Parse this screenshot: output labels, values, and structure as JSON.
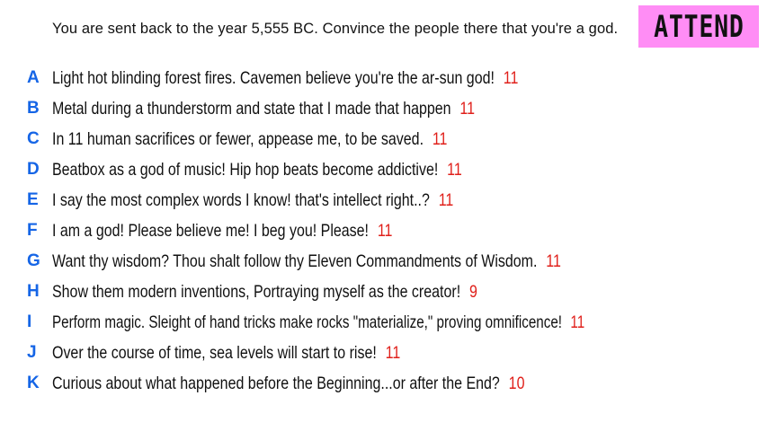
{
  "prompt": "You are sent back to the year 5,555 BC. Convince the people there that you're a god.",
  "badge": {
    "label": "ATTEND",
    "color": "#ff8df5"
  },
  "colors": {
    "letter": "#1565e6",
    "score": "#e0201b"
  },
  "answers": [
    {
      "letter": "A",
      "text": "Light hot blinding forest fires. Cavemen believe you're the ar-sun god!",
      "score": "11"
    },
    {
      "letter": "B",
      "text": "Metal during a thunderstorm and state that I made that happen",
      "score": "11"
    },
    {
      "letter": "C",
      "text": "In 11 human sacrifices or fewer, appease me, to be saved.",
      "score": "11"
    },
    {
      "letter": "D",
      "text": "Beatbox as a god of music! Hip hop beats become addictive!",
      "score": "11"
    },
    {
      "letter": "E",
      "text": "I say the most complex words I know! that's intellect right..?",
      "score": "11"
    },
    {
      "letter": "F",
      "text": "I am a god! Please believe me! I beg you! Please!",
      "score": "11"
    },
    {
      "letter": "G",
      "text": "Want thy wisdom? Thou shalt follow thy Eleven Commandments of Wisdom.",
      "score": "11"
    },
    {
      "letter": "H",
      "text": "Show them modern inventions, Portraying myself as the creator!",
      "score": "9"
    },
    {
      "letter": "I",
      "text": "Perform magic. Sleight of hand tricks make rocks \"materialize,\" proving omnificence!",
      "score": "11"
    },
    {
      "letter": "J",
      "text": "Over the course of time, sea levels will start to rise!",
      "score": "11"
    },
    {
      "letter": "K",
      "text": "Curious about what happened before the Beginning...or after the End?",
      "score": "10"
    }
  ]
}
